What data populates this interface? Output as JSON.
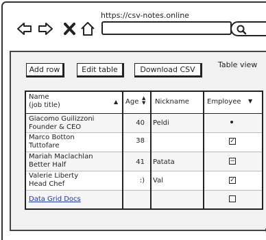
{
  "browser": {
    "url": "https://csv-notes.online",
    "address_value": "",
    "search_value": ""
  },
  "toolbar": {
    "add_row": "Add row",
    "edit_table": "Edit table",
    "download_csv": "Download CSV",
    "view_title": "Table view"
  },
  "table": {
    "columns": {
      "name": "Name",
      "name_sub": "(job title)",
      "age": "Age",
      "nickname": "Nickname",
      "employee": "Employee"
    },
    "rows": [
      {
        "name": "Giacomo Guilizzoni",
        "title": "Founder & CEO",
        "age": "40",
        "nickname": "Peldi",
        "employee": "radio-selected"
      },
      {
        "name": "Marco Botton",
        "title": "Tuttofare",
        "age": "38",
        "nickname": "",
        "employee": "checked"
      },
      {
        "name": "Mariah Maclachlan",
        "title": "Better Half",
        "age": "41",
        "nickname": "Patata",
        "employee": "indeterminate"
      },
      {
        "name": "Valerie Liberty",
        "title": "Head Chef",
        "age": ":)",
        "nickname": "Val",
        "employee": "checked"
      },
      {
        "name": "Data Grid Docs",
        "title": "",
        "age": "",
        "nickname": "",
        "employee": "unchecked"
      }
    ]
  }
}
